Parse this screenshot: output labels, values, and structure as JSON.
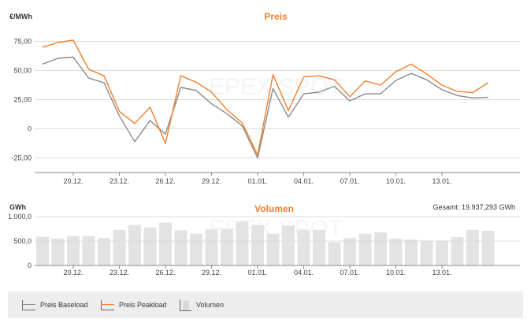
{
  "chart_data": [
    {
      "type": "line",
      "title": "Preis",
      "ylabel": "€/MWh",
      "ylim": [
        -37.5,
        87.5
      ],
      "yticks": [
        "75,00",
        "50,00",
        "25,00",
        "0",
        "-25,00"
      ],
      "ytick_values": [
        75,
        50,
        25,
        0,
        -25
      ],
      "watermark": "EPEX SPOT",
      "xtick_labels": [
        "20.12.",
        "23.12.",
        "26.12.",
        "29.12.",
        "01.01.",
        "04.01.",
        "07.01.",
        "10.01.",
        "13.01."
      ],
      "xtick_index": [
        2,
        5,
        8,
        11,
        14,
        17,
        20,
        23,
        26
      ],
      "n_points": 31,
      "series": [
        {
          "name": "Preis Baseload",
          "color": "#8a8a8a",
          "values": [
            55.5,
            60.5,
            61.5,
            43.5,
            39.5,
            11,
            -11,
            7,
            -4.5,
            35.5,
            33,
            21.5,
            13,
            2.5,
            -25,
            34.5,
            10,
            30,
            31.5,
            36.5,
            24,
            30,
            30,
            41.5,
            47.5,
            42,
            33.5,
            28.5,
            26.5,
            27
          ]
        },
        {
          "name": "Preis Peakload",
          "color": "#f07f2f",
          "values": [
            70,
            74,
            76,
            51,
            45.5,
            15,
            4.5,
            18.5,
            -12.5,
            45.5,
            40,
            31.5,
            16.5,
            5,
            -22.5,
            46.5,
            15.5,
            44.5,
            45.5,
            42,
            27.5,
            41,
            37.5,
            49,
            55.5,
            47,
            37.5,
            32,
            31,
            39.5
          ]
        }
      ]
    },
    {
      "type": "bar",
      "title": "Volumen",
      "ylabel": "GWh",
      "total_label": "Gesamt: 19.937,293 GWh",
      "ylim": [
        0,
        1000
      ],
      "yticks": [
        "1.000,0",
        "500,0",
        "0"
      ],
      "ytick_values": [
        1000,
        500,
        0
      ],
      "watermark": "EPEX SPOT",
      "xtick_labels": [
        "20.12.",
        "23.12.",
        "26.12.",
        "29.12.",
        "01.01.",
        "04.01.",
        "07.01.",
        "10.01.",
        "13.01."
      ],
      "xtick_index": [
        2,
        5,
        8,
        11,
        14,
        17,
        20,
        23,
        26
      ],
      "series": [
        {
          "name": "Volumen",
          "color": "#e3e3e3",
          "values": [
            590,
            550,
            600,
            600,
            560,
            730,
            830,
            780,
            880,
            720,
            650,
            740,
            750,
            900,
            830,
            650,
            820,
            730,
            730,
            480,
            560,
            650,
            680,
            550,
            530,
            510,
            500,
            580,
            730,
            710
          ]
        }
      ]
    }
  ],
  "legend": [
    {
      "label": "Preis Baseload",
      "color": "#8a8a8a",
      "kind": "line"
    },
    {
      "label": "Preis Peakload",
      "color": "#f07f2f",
      "kind": "line"
    },
    {
      "label": "Volumen",
      "color": "#e3e3e3",
      "kind": "bar"
    }
  ]
}
